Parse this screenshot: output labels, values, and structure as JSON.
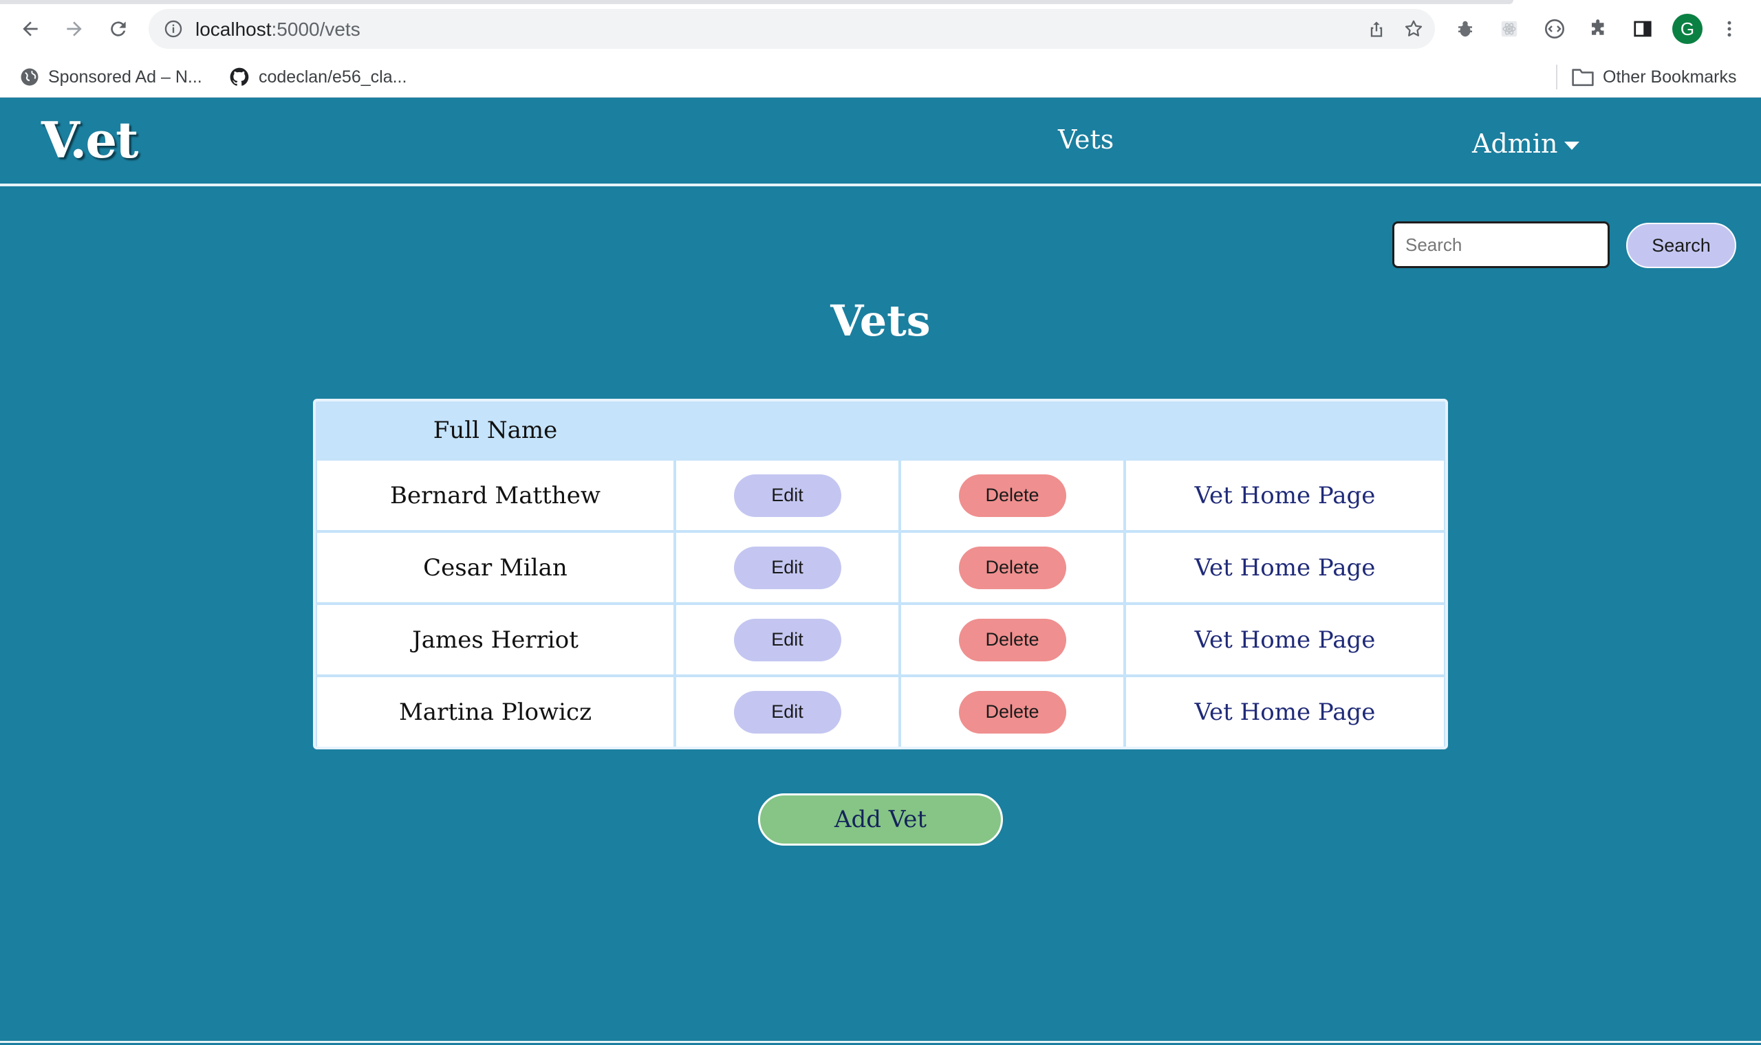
{
  "browser": {
    "url_host": "localhost",
    "url_path": ":5000/vets",
    "bookmarks": [
      {
        "label": "Sponsored Ad – N...",
        "icon": "globe-icon"
      },
      {
        "label": "codeclan/e56_cla...",
        "icon": "github-icon"
      }
    ],
    "other_bookmarks": "Other Bookmarks",
    "profile_initial": "G"
  },
  "header": {
    "brand": "V.et",
    "nav_vets": "Vets",
    "nav_admin": "Admin"
  },
  "search": {
    "placeholder": "Search",
    "button_label": "Search"
  },
  "page": {
    "title": "Vets"
  },
  "table": {
    "header_name": "Full Name",
    "edit_label": "Edit",
    "delete_label": "Delete",
    "link_label": "Vet Home Page",
    "rows": [
      {
        "name": "Bernard Matthew"
      },
      {
        "name": "Cesar Milan"
      },
      {
        "name": "James Herriot"
      },
      {
        "name": "Martina Plowicz"
      }
    ]
  },
  "add_button": "Add Vet",
  "colors": {
    "page_bg": "#1b7f9f",
    "table_header_bg": "#c5e3fa",
    "edit_button": "#c4c6f1",
    "delete_button": "#ef8f8f",
    "add_button": "#86c585",
    "link": "#1f2a78"
  }
}
